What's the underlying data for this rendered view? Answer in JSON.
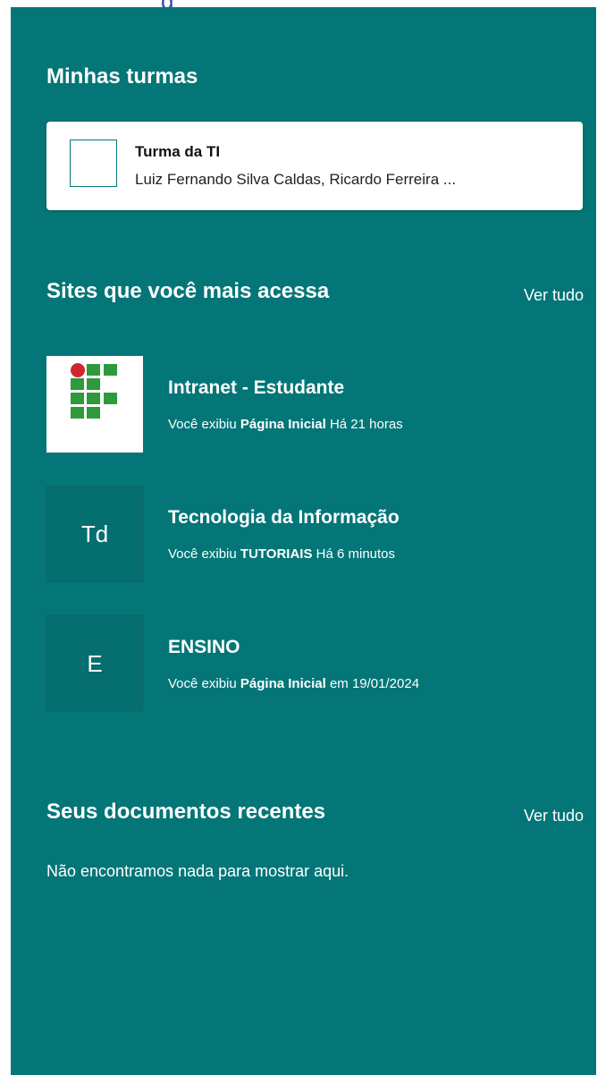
{
  "top_fragment": "g",
  "my_classes": {
    "title": "Minhas turmas",
    "items": [
      {
        "name": "Turma da TI",
        "members": "Luiz Fernando Silva Caldas, Ricardo Ferreira ..."
      }
    ]
  },
  "frequent_sites": {
    "title": "Sites que você mais acessa",
    "see_all": "Ver tudo",
    "items": [
      {
        "name": "Intranet - Estudante",
        "activity_prefix": "Você exibiu",
        "activity_page": "Página Inicial",
        "activity_time": "Há 21 horas",
        "tile": "logo",
        "icon": "ifpb-logo"
      },
      {
        "name": "Tecnologia da Informação",
        "activity_prefix": "Você exibiu",
        "activity_page": "TUTORIAIS",
        "activity_time": "Há 6 minutos",
        "tile": "letter",
        "initials": "Td"
      },
      {
        "name": "ENSINO",
        "activity_prefix": "Você exibiu",
        "activity_page": "Página Inicial",
        "activity_time": "em 19/01/2024",
        "tile": "letter",
        "initials": "E"
      }
    ]
  },
  "recent_documents": {
    "title": "Seus documentos recentes",
    "see_all": "Ver tudo",
    "empty_message": "Não encontramos nada para mostrar aqui."
  },
  "colors": {
    "panel_bg": "#047677",
    "logo_green": "#2e9a3c",
    "logo_red": "#d0262f"
  }
}
